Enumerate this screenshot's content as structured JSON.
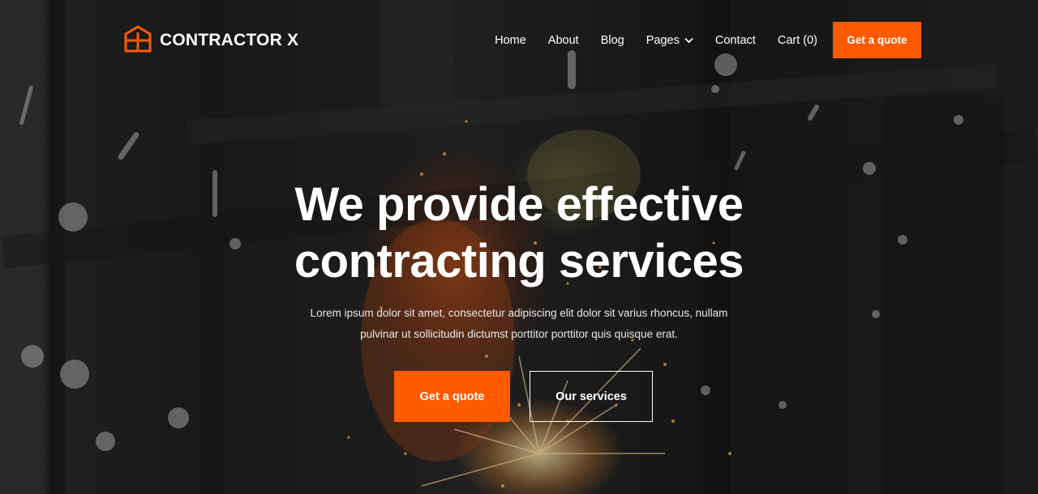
{
  "brand": {
    "name": "CONTRACTOR X",
    "logo_icon": "house-frame-icon",
    "accent_color": "#ff5a00"
  },
  "nav": {
    "items": [
      {
        "label": "Home"
      },
      {
        "label": "About"
      },
      {
        "label": "Blog"
      },
      {
        "label": "Pages",
        "icon": "chevron-down-icon"
      },
      {
        "label": "Contact"
      },
      {
        "label": "Cart (0)"
      }
    ],
    "cta_label": "Get a quote"
  },
  "hero": {
    "title_line1": "We provide effective",
    "title_line2": "contracting services",
    "subtitle": "Lorem ipsum dolor sit amet, consectetur adipiscing elit dolor sit varius rhoncus, nullam pulvinar ut sollicitudin dictumst porttitor porttitor quis quisque erat.",
    "primary_button": "Get a quote",
    "secondary_button": "Our services"
  }
}
